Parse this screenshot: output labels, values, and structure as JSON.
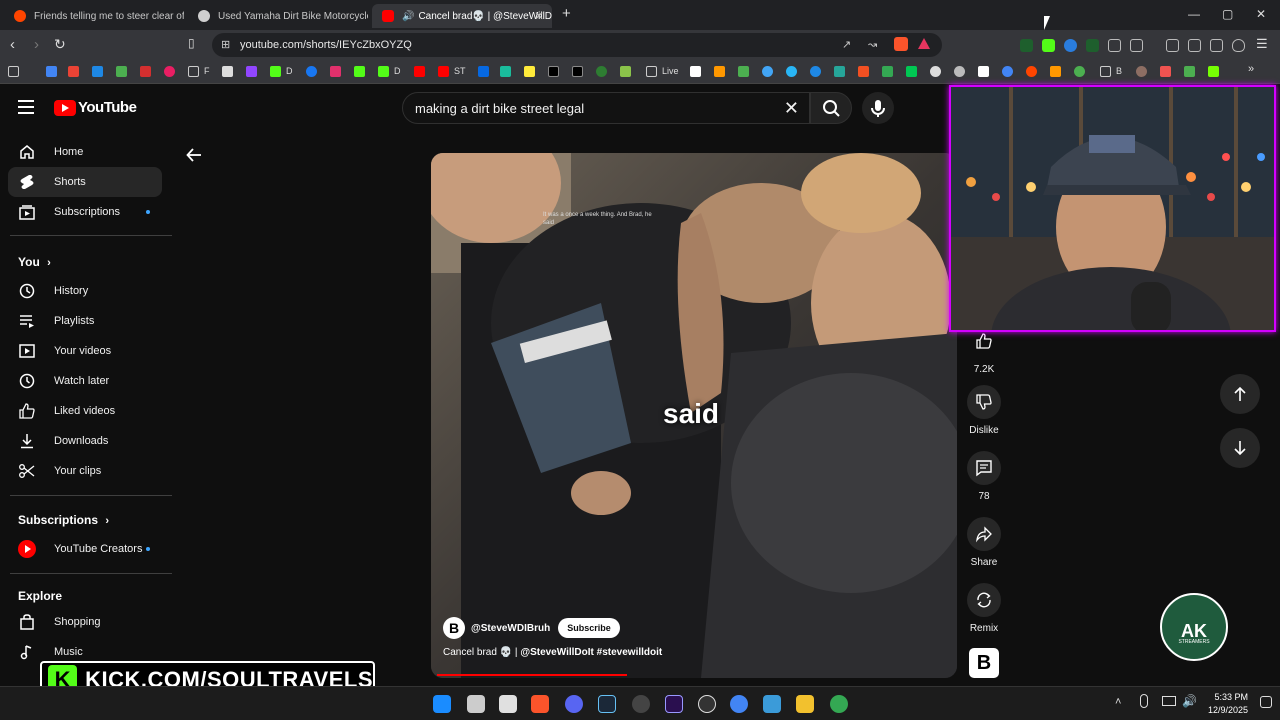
{
  "browser": {
    "tabs": [
      {
        "title": "Friends telling me to steer clear of ka",
        "icon_color": "#ff4500"
      },
      {
        "title": "Used Yamaha Dirt Bike Motorcycles",
        "icon_color": "#cfcfcf"
      },
      {
        "title": "Cancel brad💀 | @SteveWillD",
        "icon_color": "#ff0000",
        "active": true
      }
    ],
    "new_tab": "+",
    "url": "youtube.com/shorts/IEYcZbxOYZQ",
    "window_controls": {
      "minimize": "—",
      "maximize": "▢",
      "close": "✕"
    },
    "bookmarks": [
      {
        "label": "F"
      },
      {
        "label": "D"
      },
      {
        "label": "D"
      },
      {
        "label": "ST"
      },
      {
        "label": "Live"
      },
      {
        "label": "B"
      }
    ]
  },
  "youtube": {
    "logo_text": "YouTube",
    "search_value": "making a dirt bike street legal",
    "sidebar": {
      "main": [
        {
          "label": "Home",
          "icon": "home-icon"
        },
        {
          "label": "Shorts",
          "icon": "shorts-icon",
          "active": true
        },
        {
          "label": "Subscriptions",
          "icon": "subscriptions-icon",
          "dot": true
        }
      ],
      "you_header": "You",
      "you": [
        {
          "label": "History",
          "icon": "history-icon"
        },
        {
          "label": "Playlists",
          "icon": "playlists-icon"
        },
        {
          "label": "Your videos",
          "icon": "your-videos-icon"
        },
        {
          "label": "Watch later",
          "icon": "watch-later-icon"
        },
        {
          "label": "Liked videos",
          "icon": "liked-videos-icon"
        },
        {
          "label": "Downloads",
          "icon": "downloads-icon"
        },
        {
          "label": "Your clips",
          "icon": "clips-icon"
        }
      ],
      "subscriptions_header": "Subscriptions",
      "subscriptions": [
        {
          "label": "YouTube Creators",
          "icon": "youtube-creators-avatar",
          "dot": true
        }
      ],
      "explore_header": "Explore",
      "explore": [
        {
          "label": "Shopping",
          "icon": "shopping-icon"
        },
        {
          "label": "Music",
          "icon": "music-icon"
        }
      ]
    },
    "short": {
      "caption": "said",
      "tiny_caption": "It was a once a week thing. And Brad, he said",
      "channel": "@SteveWDIBruh",
      "subscribe": "Subscribe",
      "title_prefix": "Cancel brad 💀 | ",
      "title_bold": "@SteveWillDoIt #stevewilldoit",
      "progress": 0.37
    },
    "actions": {
      "likes": "7.2K",
      "dislike": "Dislike",
      "comments": "78",
      "share": "Share",
      "remix": "Remix"
    }
  },
  "overlay": {
    "kick_text": "KICK.COM/SOULTRAVELS",
    "kick_letter": "K",
    "ak_logo": "AK",
    "ak_sub": "STREAMERS"
  },
  "taskbar": {
    "time": "5:33 PM",
    "date": "12/9/2025"
  }
}
